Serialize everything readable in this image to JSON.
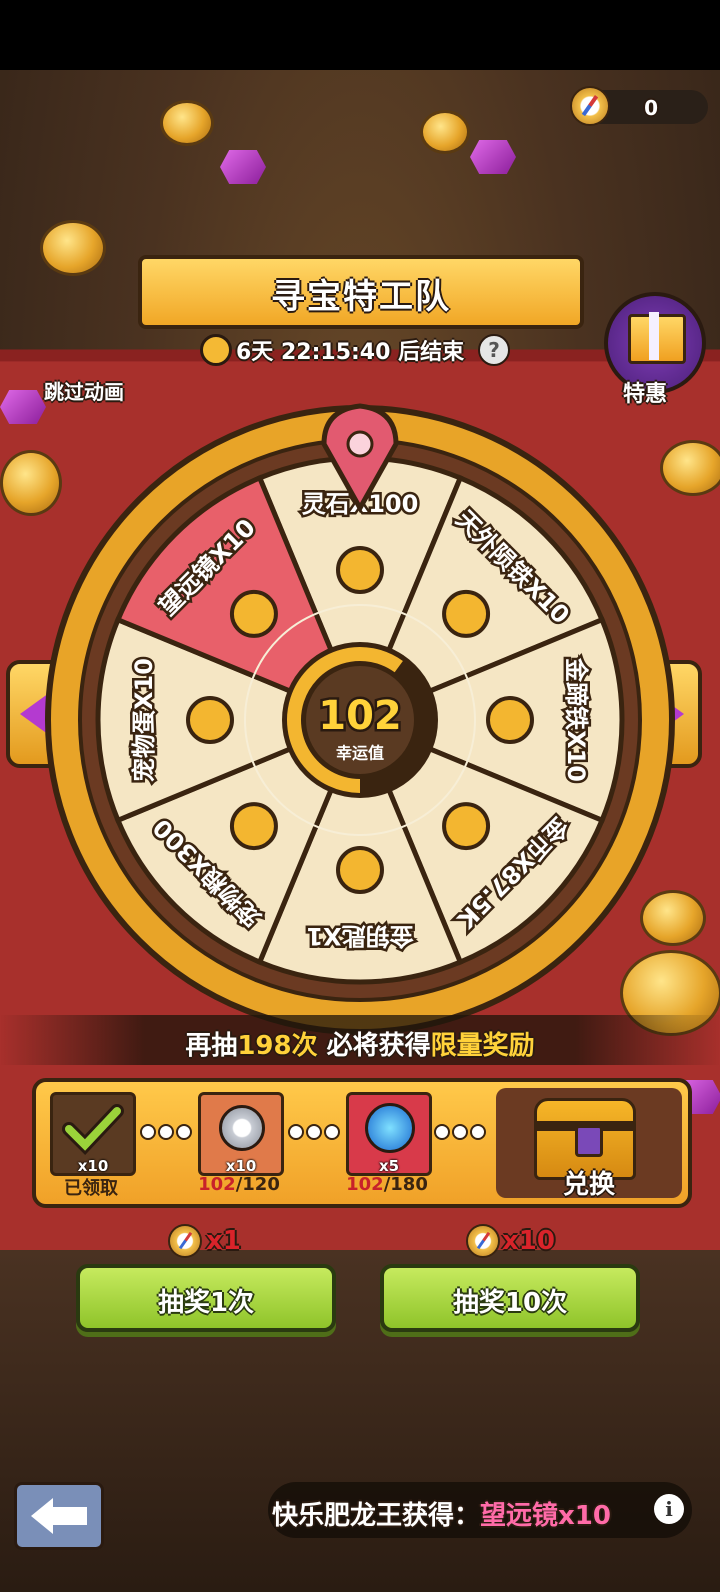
{
  "hud": {
    "compass_count": "0"
  },
  "title": "寻宝特工队",
  "timer": "6天 22:15:40 后结束",
  "help_icon": "?",
  "skip_label": "跳过动画",
  "special_label": "特惠",
  "wheel": {
    "center_value": "102",
    "center_label": "幸运值",
    "center_progress": 0.6,
    "segments": [
      {
        "label": "灵石X100",
        "icon": "spirit-stone-icon",
        "color": "#f5e6c4"
      },
      {
        "label": "天外陨铁X10",
        "icon": "meteorite-icon",
        "color": "#f5e6c4"
      },
      {
        "label": "金蹄铁X10",
        "icon": "horseshoe-icon",
        "color": "#f5e6c4"
      },
      {
        "label": "金币X87.5K",
        "icon": "coin-icon",
        "color": "#f5e6c4"
      },
      {
        "label": "金钥匙X1",
        "icon": "key-icon",
        "color": "#f5e6c4"
      },
      {
        "label": "宠物粮X300",
        "icon": "bone-icon",
        "color": "#f5e6c4"
      },
      {
        "label": "宠物蛋X10",
        "icon": "egg-icon",
        "color": "#f5e6c4"
      },
      {
        "label": "望远镜X10",
        "icon": "telescope-icon",
        "color": "#e8606a"
      }
    ]
  },
  "guarantee": {
    "prefix": "再抽",
    "count": "198次",
    "middle": " 必将获得",
    "reward": "限量奖励"
  },
  "milestones": [
    {
      "count": "x10",
      "status": "已领取",
      "claimed": true
    },
    {
      "count": "x10",
      "progress": "102",
      "target": "/120"
    },
    {
      "count": "x5",
      "progress": "102",
      "target": "/180"
    }
  ],
  "exchange_label": "兑换",
  "draw": [
    {
      "cost": "x1",
      "label": "抽奖1次"
    },
    {
      "cost": "x10",
      "label": "抽奖10次"
    }
  ],
  "notice": {
    "prefix": "快乐肥龙王获得：",
    "item": "望远镜x10",
    "info_icon": "i"
  },
  "colors": {
    "accent_gold": "#f1a726",
    "button_green": "#8fc42a",
    "highlight_red": "#d9232a",
    "wheel_rim": "#e8a428"
  }
}
